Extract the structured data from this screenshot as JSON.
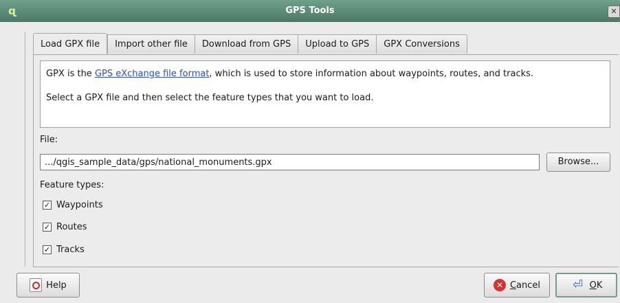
{
  "window": {
    "title": "GPS Tools",
    "app_icon": "qgis-icon",
    "close_glyph": "✕"
  },
  "tabs": [
    {
      "label": "Load GPX file",
      "active": true
    },
    {
      "label": "Import other file",
      "active": false
    },
    {
      "label": "Download from GPS",
      "active": false
    },
    {
      "label": "Upload to GPS",
      "active": false
    },
    {
      "label": "GPX Conversions",
      "active": false
    }
  ],
  "info": {
    "line1_prefix": "GPX is the ",
    "line1_link": "GPS eXchange file format",
    "line1_suffix": ", which is used to store information about waypoints, routes, and tracks.",
    "line2": "Select a GPX file and then select the feature types that you want to load."
  },
  "file": {
    "label": "File:",
    "value": ".../qgis_sample_data/gps/national_monuments.gpx",
    "browse_label": "Browse..."
  },
  "feature_types": {
    "label": "Feature types:",
    "items": [
      {
        "label": "Waypoints",
        "checked": true
      },
      {
        "label": "Routes",
        "checked": true
      },
      {
        "label": "Tracks",
        "checked": true
      }
    ]
  },
  "buttons": {
    "help": "Help",
    "cancel_mnemonic": "C",
    "cancel_rest": "ancel",
    "ok_mnemonic": "O",
    "ok_rest": "K"
  },
  "colors": {
    "titlebar": "#5a8a76",
    "link": "#2b4bd6",
    "cancel_icon": "#d8312a"
  }
}
